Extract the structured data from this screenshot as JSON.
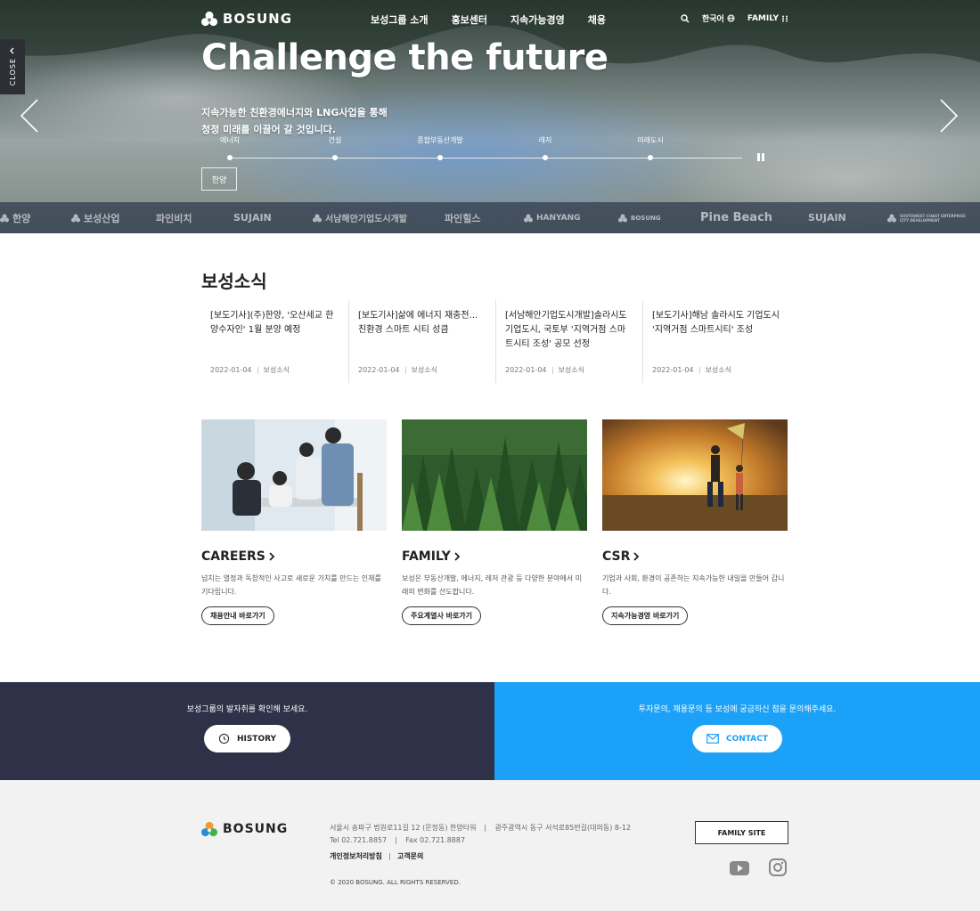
{
  "header": {
    "logo_text": "BOSUNG",
    "nav": [
      "보성그룹 소개",
      "홍보센터",
      "지속가능경영",
      "채용"
    ],
    "language": "한국어",
    "family": "FAMILY"
  },
  "side_tab": {
    "label": "CLOSE"
  },
  "hero": {
    "title": "Challenge the future",
    "subtitle_line1": "지속가능한 친환경에너지와 LNG사업을 통해",
    "subtitle_line2": "청정 미래를 이끌어 갈 것입니다.",
    "steps": [
      "에너지",
      "건설",
      "종합부동산개발",
      "레저",
      "미래도시"
    ],
    "button": "한양"
  },
  "brands": [
    "한양",
    "보성산업",
    "파인비치",
    "SUJAIN",
    "서남해안기업도시개발",
    "파인힐스",
    "HANYANG",
    "BOSUNG",
    "Pine Beach",
    "SUJAIN",
    "SOUTHWEST COAST ENTERPRISE CITY DEVELOPMENT"
  ],
  "news": {
    "title": "보성소식",
    "items": [
      {
        "headline": "[보도기사](주)한양, '오산세교 한양수자인' 1월 분양 예정",
        "date": "2022-01-04",
        "category": "보성소식"
      },
      {
        "headline": "[보도기사]삶에 에너지 재충전... 친환경 스마트 시티 성큼",
        "date": "2022-01-04",
        "category": "보성소식"
      },
      {
        "headline": "[서남해안기업도시개발]솔라시도 기업도시, 국토부 '지역거점 스마트시티 조성' 공모 선정",
        "date": "2022-01-04",
        "category": "보성소식"
      },
      {
        "headline": "[보도기사]해남 솔라시도 기업도시 '지역거점 스마트시티' 조성",
        "date": "2022-01-04",
        "category": "보성소식"
      }
    ]
  },
  "cards": [
    {
      "title": "CAREERS",
      "desc": "넘치는 열정과 독창적인 사고로 새로운 가치를 만드는 인재를 기다립니다.",
      "cta": "채용안내 바로가기"
    },
    {
      "title": "FAMILY",
      "desc": "보성은 부동산개발, 에너지, 레저 관광 등 다양한 분야에서 미래의 변화를 선도합니다.",
      "cta": "주요계열사 바로가기"
    },
    {
      "title": "CSR",
      "desc": "기업과 사회, 환경이 공존하는 지속가능한 내일을 만들어 갑니다.",
      "cta": "지속가능경영 바로가기"
    }
  ],
  "banners": {
    "history": {
      "message": "보성그룹의 발자취를 확인해 보세요.",
      "button": "HISTORY"
    },
    "contact": {
      "message": "투자문의, 채용문의 등 보성에 궁금하신 점을 문의해주세요.",
      "button": "CONTACT"
    }
  },
  "footer": {
    "logo_text": "BOSUNG",
    "address1": "서울시 송파구 법원로11길 12 (문정동) 한양타워",
    "address2": "광주광역시 동구 서석로85번길(대의동) 8-12",
    "tel": "Tel 02.721.8857",
    "fax": "Fax 02.721.8887",
    "privacy": "개인정보처리방침",
    "inquiry": "고객문의",
    "copyright": "© 2020 BOSUNG. ALL RIGHTS RESERVED.",
    "family_site": "FAMILY SITE"
  },
  "colors": {
    "history_bg": "#2e3148",
    "contact_bg": "#1ba1f7",
    "footer_bg": "#f2f2f2"
  }
}
